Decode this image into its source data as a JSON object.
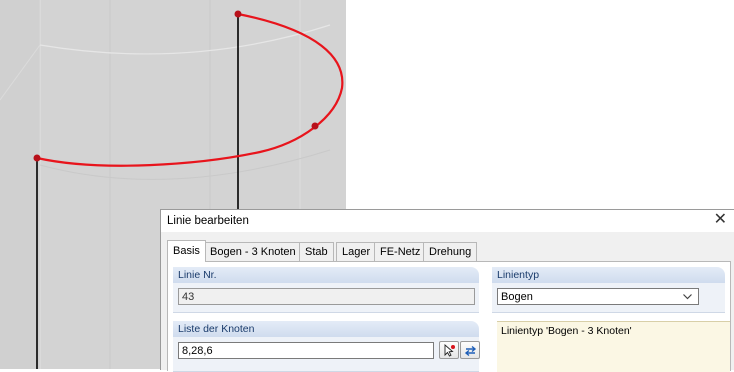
{
  "dialog": {
    "title": "Linie bearbeiten",
    "close_glyph": "✕",
    "tabs": [
      {
        "label": "Basis",
        "active": true
      },
      {
        "label": "Bogen - 3 Knoten",
        "active": false
      },
      {
        "label": "Stab",
        "active": false
      },
      {
        "label": "Lager",
        "active": false
      },
      {
        "label": "FE-Netz",
        "active": false
      },
      {
        "label": "Drehung",
        "active": false
      }
    ],
    "line_no": {
      "label": "Linie Nr.",
      "value": "43"
    },
    "line_type": {
      "label": "Linientyp",
      "value": "Bogen"
    },
    "nodes": {
      "label": "Liste der Knoten",
      "value": "8,28,6"
    },
    "info_text": "Linientyp 'Bogen - 3 Knoten'"
  },
  "icons": {
    "pick": "pick-node-icon",
    "reverse": "reverse-direction-icon",
    "dropdown": "chevron-down-icon"
  },
  "colors": {
    "viewport_bg": "#d3d3d3",
    "arc": "#e8141c",
    "node": "#b8101a",
    "member": "#000000",
    "group_header": "#cfdcee",
    "info_bg": "#fbf7e4"
  }
}
